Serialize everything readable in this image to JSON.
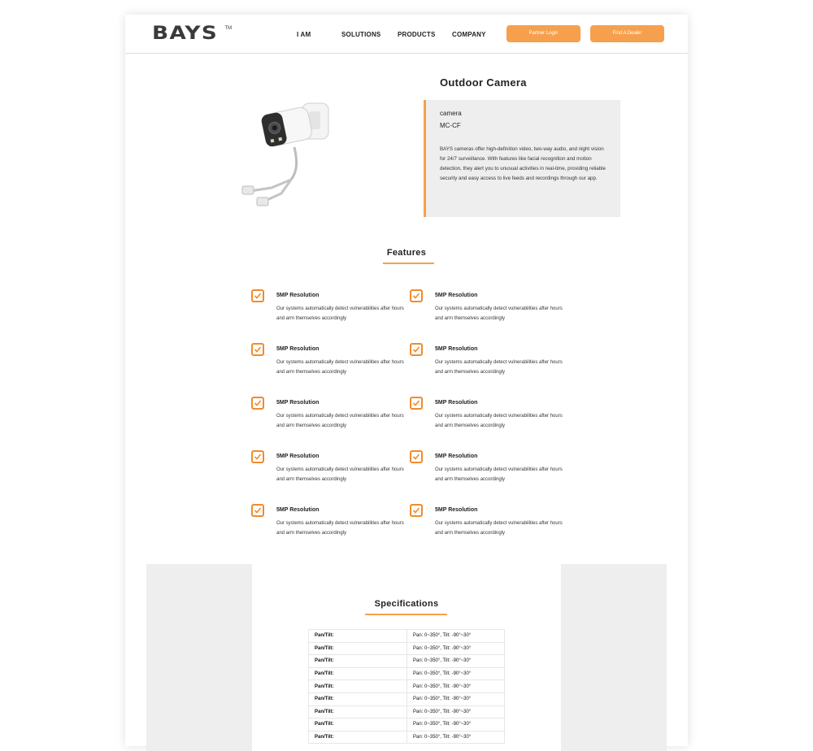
{
  "brand": {
    "logo": "BAYS",
    "tm": "TM"
  },
  "nav": {
    "items": [
      "I AM",
      "SOLUTIONS",
      "PRODUCTS",
      "COMPANY"
    ]
  },
  "buttons": {
    "partner": "Partner Login",
    "dealer": "Find A Dealer"
  },
  "product": {
    "title": "Outdoor Camera",
    "category": "camera",
    "model": "MC-CF",
    "description": "BAYS cameras offer high-definition video, two-way audio, and night vision for 24/7 surveillance. With features like facial recognition and motion detection, they alert you to unusual activities in real-time, providing reliable security and easy access to live feeds and recordings through our app."
  },
  "features": {
    "title": "Features",
    "items": [
      {
        "title": "5MP Resolution",
        "desc": "Our systems automatically detect vulnerabilities after hours and arm themselves accordingly"
      },
      {
        "title": "5MP Resolution",
        "desc": "Our systems automatically detect vulnerabilities after hours and arm themselves accordingly"
      },
      {
        "title": "5MP Resolution",
        "desc": "Our systems automatically detect vulnerabilities after hours and arm themselves accordingly"
      },
      {
        "title": "5MP Resolution",
        "desc": "Our systems automatically detect vulnerabilities after hours and arm themselves accordingly"
      },
      {
        "title": "5MP Resolution",
        "desc": "Our systems automatically detect vulnerabilities after hours and arm themselves accordingly"
      },
      {
        "title": "5MP Resolution",
        "desc": "Our systems automatically detect vulnerabilities after hours and arm themselves accordingly"
      },
      {
        "title": "5MP Resolution",
        "desc": "Our systems automatically detect vulnerabilities after hours and arm themselves accordingly"
      },
      {
        "title": "5MP Resolution",
        "desc": "Our systems automatically detect vulnerabilities after hours and arm themselves accordingly"
      },
      {
        "title": "5MP Resolution",
        "desc": "Our systems automatically detect vulnerabilities after hours and arm themselves accordingly"
      },
      {
        "title": "5MP Resolution",
        "desc": "Our systems automatically detect vulnerabilities after hours and arm themselves accordingly"
      }
    ]
  },
  "specs": {
    "title": "Specifications",
    "rows": [
      {
        "key": "Pan/Tilt:",
        "value": "Pan: 0~350°, Tilt: -90°~30°"
      },
      {
        "key": "Pan/Tilt:",
        "value": "Pan: 0~350°, Tilt: -90°~30°"
      },
      {
        "key": "Pan/Tilt:",
        "value": "Pan: 0~350°, Tilt: -90°~30°"
      },
      {
        "key": "Pan/Tilt:",
        "value": "Pan: 0~350°, Tilt: -90°~30°"
      },
      {
        "key": "Pan/Tilt:",
        "value": "Pan: 0~350°, Tilt: -90°~30°"
      },
      {
        "key": "Pan/Tilt:",
        "value": "Pan: 0~350°, Tilt: -90°~30°"
      },
      {
        "key": "Pan/Tilt:",
        "value": "Pan: 0~350°, Tilt: -90°~30°"
      },
      {
        "key": "Pan/Tilt:",
        "value": "Pan: 0~350°, Tilt: -90°~30°"
      },
      {
        "key": "Pan/Tilt:",
        "value": "Pan: 0~350°, Tilt: -90°~30°"
      }
    ]
  },
  "colors": {
    "accent": "#f6a04d",
    "check": "#f28b2b",
    "panel": "#eeeeef"
  }
}
